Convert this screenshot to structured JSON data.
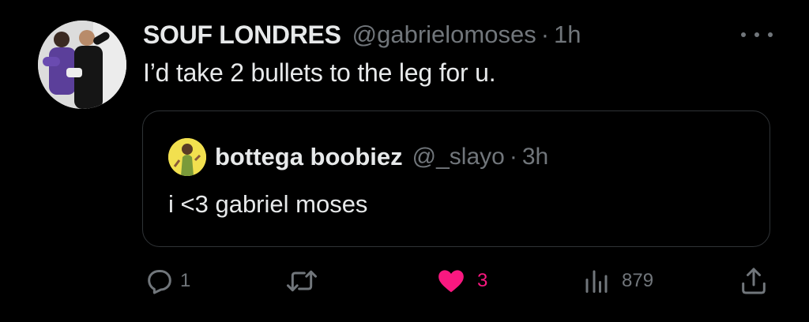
{
  "tweet": {
    "author_name": "SOUF LONDRES",
    "author_handle": "@gabrielomoses",
    "separator": "·",
    "time": "1h",
    "text": "I’d take 2 bullets to the leg for u."
  },
  "quote": {
    "author_name": "bottega boobiez",
    "author_handle": "@_slayo",
    "separator": "·",
    "time": "3h",
    "text": "i <3 gabriel moses"
  },
  "actions": {
    "reply_count": "1",
    "retweet_count": "",
    "like_count": "3",
    "views_count": "879"
  },
  "icons": {
    "reply": "reply-icon",
    "retweet": "retweet-icon",
    "like": "heart-icon",
    "views": "views-icon",
    "share": "share-icon",
    "more": "more-icon"
  },
  "colors": {
    "background": "#000000",
    "text_primary": "#e7e9ea",
    "text_secondary": "#71767b",
    "like_active": "#f91880",
    "card_border": "#2f3336"
  }
}
